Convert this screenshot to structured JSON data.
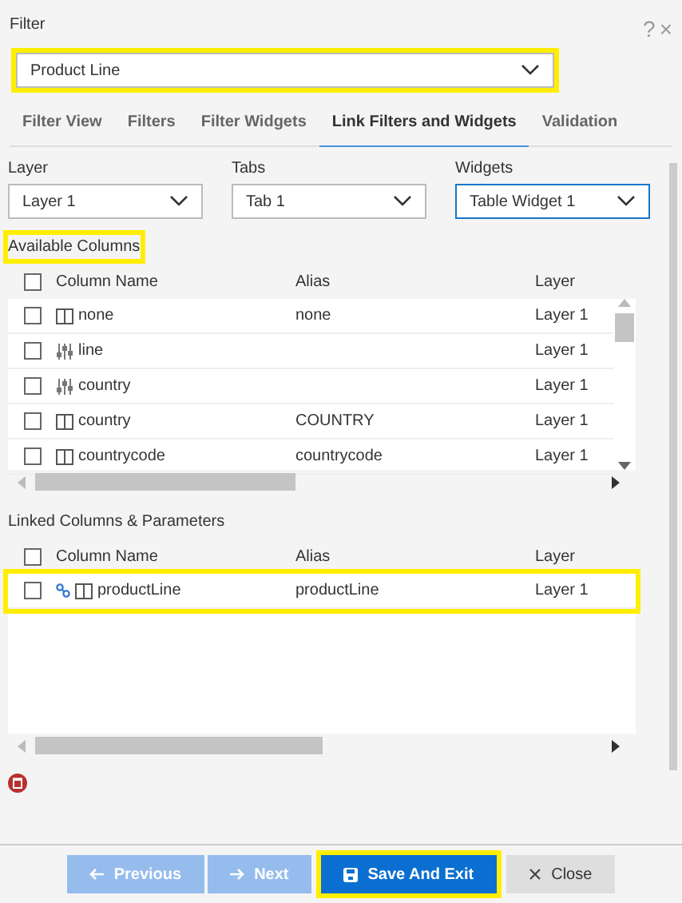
{
  "dialog": {
    "title": "Filter",
    "help": "?",
    "close": "×"
  },
  "filter_select": {
    "value": "Product Line",
    "highlighted": true
  },
  "tabs": [
    {
      "label": "Filter View",
      "selected": false
    },
    {
      "label": "Filters",
      "selected": false
    },
    {
      "label": "Filter Widgets",
      "selected": false
    },
    {
      "label": "Link Filters and Widgets",
      "selected": true
    },
    {
      "label": "Validation",
      "selected": false
    }
  ],
  "selectors": [
    {
      "label": "Layer",
      "value": "Layer 1",
      "focused": false
    },
    {
      "label": "Tabs",
      "value": "Tab 1",
      "focused": false
    },
    {
      "label": "Widgets",
      "value": "Table Widget 1",
      "focused": true
    }
  ],
  "available": {
    "title": "Available Columns",
    "highlighted": true,
    "columns": [
      "Column Name",
      "Alias",
      "Layer"
    ],
    "header_checked": false,
    "rows": [
      {
        "kind": "column",
        "name": "none",
        "alias": "none",
        "layer": "Layer 1",
        "checked": false
      },
      {
        "kind": "parameter",
        "name": "line",
        "alias": "",
        "layer": "Layer 1",
        "checked": false
      },
      {
        "kind": "parameter",
        "name": "country",
        "alias": "",
        "layer": "Layer 1",
        "checked": false
      },
      {
        "kind": "column",
        "name": "country",
        "alias": "COUNTRY",
        "layer": "Layer 1",
        "checked": false
      },
      {
        "kind": "column",
        "name": "countrycode",
        "alias": "countrycode",
        "layer": "Layer 1",
        "checked": false
      }
    ]
  },
  "linked": {
    "title": "Linked Columns & Parameters",
    "highlighted": false,
    "columns": [
      "Column Name",
      "Alias",
      "Layer"
    ],
    "header_checked": false,
    "rows": [
      {
        "kind": "column",
        "linked": true,
        "name": "productLine",
        "alias": "productLine",
        "layer": "Layer 1",
        "checked": false,
        "highlighted": true
      }
    ]
  },
  "buttons": [
    {
      "kind": "previous",
      "label": "Previous",
      "disabled": true,
      "highlighted": false
    },
    {
      "kind": "next",
      "label": "Next",
      "disabled": true,
      "highlighted": false
    },
    {
      "kind": "save",
      "label": "Save And Exit",
      "disabled": false,
      "highlighted": true
    },
    {
      "kind": "close",
      "label": "Close",
      "disabled": false,
      "highlighted": false
    }
  ]
}
